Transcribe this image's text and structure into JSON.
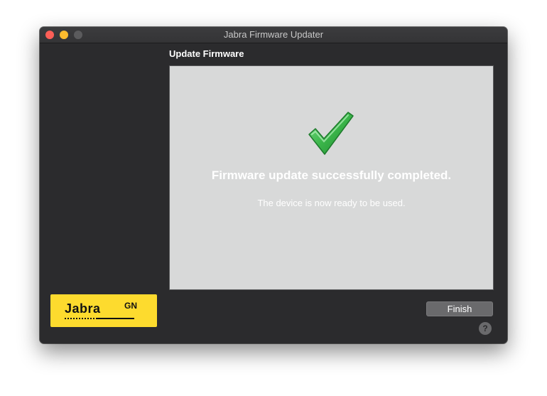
{
  "window": {
    "title": "Jabra Firmware Updater"
  },
  "section": {
    "title": "Update Firmware"
  },
  "status": {
    "icon": "checkmark-icon",
    "message": "Firmware update successfully completed.",
    "detail": "The device is now ready to be used."
  },
  "logo": {
    "brand": "Jabra",
    "mark": "GN",
    "color": "#fddb2e"
  },
  "actions": {
    "finish_label": "Finish",
    "help_label": "?"
  },
  "colors": {
    "window_background": "#2b2b2d",
    "panel_background": "#d8d9d9",
    "success_green": "#3bb54a"
  }
}
